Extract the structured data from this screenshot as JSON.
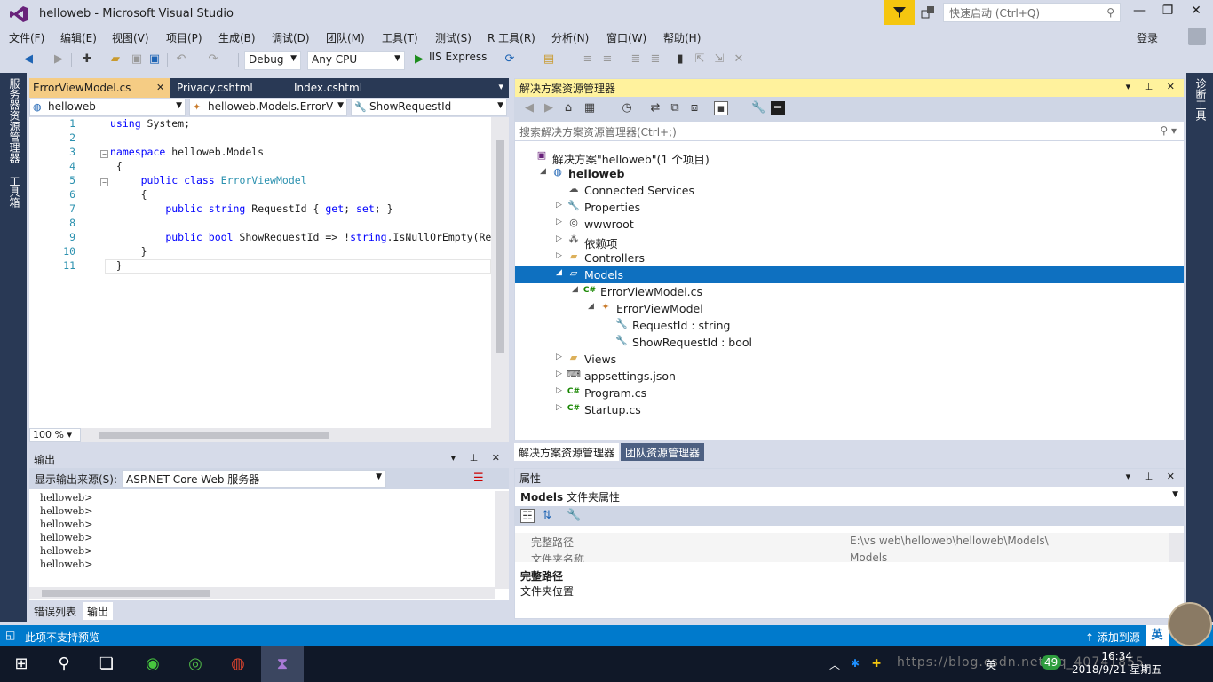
{
  "window": {
    "title": "helloweb - Microsoft Visual Studio",
    "quick_launch_placeholder": "快速启动 (Ctrl+Q)",
    "login": "登录"
  },
  "menu": [
    "文件(F)",
    "编辑(E)",
    "视图(V)",
    "项目(P)",
    "生成(B)",
    "调试(D)",
    "团队(M)",
    "工具(T)",
    "测试(S)",
    "R 工具(R)",
    "分析(N)",
    "窗口(W)",
    "帮助(H)"
  ],
  "toolbar": {
    "config": "Debug",
    "platform": "Any CPU",
    "run": "IIS Express"
  },
  "side_tabs": {
    "left1": "服务器资源管理器",
    "left2": "工具箱",
    "right1": "诊断工具"
  },
  "editor": {
    "tabs": [
      "ErrorViewModel.cs",
      "Privacy.cshtml",
      "Index.cshtml"
    ],
    "nav": [
      "helloweb",
      "helloweb.Models.ErrorV",
      "ShowRequestId"
    ],
    "zoom": "100 %",
    "lines": [
      {
        "n": "1",
        "parts": [
          [
            "kw",
            "using"
          ],
          [
            "",
            " System;"
          ]
        ]
      },
      {
        "n": "2",
        "parts": []
      },
      {
        "n": "3",
        "parts": [
          [
            "kw",
            "namespace"
          ],
          [
            "",
            " helloweb.Models"
          ]
        ]
      },
      {
        "n": "4",
        "parts": [
          [
            "",
            " {"
          ]
        ]
      },
      {
        "n": "5",
        "parts": [
          [
            "",
            "     "
          ],
          [
            "kw",
            "public"
          ],
          [
            "",
            " "
          ],
          [
            "kw",
            "class"
          ],
          [
            "",
            " "
          ],
          [
            "ty",
            "ErrorViewModel"
          ]
        ]
      },
      {
        "n": "6",
        "parts": [
          [
            "",
            "     {"
          ]
        ]
      },
      {
        "n": "7",
        "parts": [
          [
            "",
            "         "
          ],
          [
            "kw",
            "public"
          ],
          [
            "",
            " "
          ],
          [
            "kw",
            "string"
          ],
          [
            "",
            " RequestId { "
          ],
          [
            "kw",
            "get"
          ],
          [
            "",
            "; "
          ],
          [
            "kw",
            "set"
          ],
          [
            "",
            "; }"
          ]
        ]
      },
      {
        "n": "8",
        "parts": []
      },
      {
        "n": "9",
        "parts": [
          [
            "",
            "         "
          ],
          [
            "kw",
            "public"
          ],
          [
            "",
            " "
          ],
          [
            "kw",
            "bool"
          ],
          [
            "",
            " ShowRequestId => !"
          ],
          [
            "kw",
            "string"
          ],
          [
            "",
            ".IsNullOrEmpty(Re"
          ]
        ]
      },
      {
        "n": "10",
        "parts": [
          [
            "",
            "     }"
          ]
        ]
      },
      {
        "n": "11",
        "parts": [
          [
            "",
            " }"
          ]
        ]
      }
    ]
  },
  "output": {
    "title": "输出",
    "source_label": "显示输出来源(S):",
    "source_value": "ASP.NET Core Web 服务器",
    "lines": [
      "helloweb>",
      "helloweb>",
      "helloweb>",
      "helloweb>",
      "helloweb>",
      "helloweb>"
    ],
    "bottom_tabs": [
      "错误列表",
      "输出"
    ]
  },
  "solution_explorer": {
    "title": "解决方案资源管理器",
    "search_placeholder": "搜索解决方案资源管理器(Ctrl+;)",
    "items": [
      {
        "label": "解决方案\"helloweb\"(1 个项目)",
        "icon": "solution-icon",
        "depth": 0,
        "expander": ""
      },
      {
        "label": "helloweb",
        "icon": "web-project-icon",
        "depth": 1,
        "expander": "open",
        "bold": true
      },
      {
        "label": "Connected Services",
        "icon": "connected-services-icon",
        "depth": 2,
        "expander": ""
      },
      {
        "label": "Properties",
        "icon": "wrench-icon",
        "depth": 2,
        "expander": "closed"
      },
      {
        "label": "wwwroot",
        "icon": "globe-icon",
        "depth": 2,
        "expander": "closed"
      },
      {
        "label": "依赖项",
        "icon": "dependencies-icon",
        "depth": 2,
        "expander": "closed"
      },
      {
        "label": "Controllers",
        "icon": "folder-icon",
        "depth": 2,
        "expander": "closed"
      },
      {
        "label": "Models",
        "icon": "folder-open-icon",
        "depth": 2,
        "expander": "open",
        "selected": true
      },
      {
        "label": "ErrorViewModel.cs",
        "icon": "csharp-file-icon",
        "depth": 3,
        "expander": "open"
      },
      {
        "label": "ErrorViewModel",
        "icon": "class-icon",
        "depth": 4,
        "expander": "open"
      },
      {
        "label": "RequestId : string",
        "icon": "property-wrench-icon",
        "depth": 5,
        "expander": ""
      },
      {
        "label": "ShowRequestId : bool",
        "icon": "property-wrench-icon",
        "depth": 5,
        "expander": ""
      },
      {
        "label": "Views",
        "icon": "folder-icon",
        "depth": 2,
        "expander": "closed"
      },
      {
        "label": "appsettings.json",
        "icon": "json-file-icon",
        "depth": 2,
        "expander": "closed"
      },
      {
        "label": "Program.cs",
        "icon": "csharp-file-icon",
        "depth": 2,
        "expander": "closed"
      },
      {
        "label": "Startup.cs",
        "icon": "csharp-file-icon",
        "depth": 2,
        "expander": "closed"
      }
    ],
    "bottom_tabs": [
      "解决方案资源管理器",
      "团队资源管理器"
    ]
  },
  "properties": {
    "title": "属性",
    "object_name": "Models",
    "object_type": "文件夹属性",
    "rows": [
      {
        "key": "完整路径",
        "value": "E:\\vs web\\helloweb\\helloweb\\Models\\"
      },
      {
        "key": "文件夹名称",
        "value": "Models"
      }
    ],
    "desc_title": "完整路径",
    "desc_text": "文件夹位置"
  },
  "status": {
    "text": "此项不支持预览",
    "right": "添加到源",
    "ime": "英"
  },
  "taskbar": {
    "time": "16:34",
    "date": "2018/9/21 星期五",
    "tray_lang": "英",
    "badge": "49",
    "watermark": "https://blog.csdn.net/qq_40741855"
  }
}
